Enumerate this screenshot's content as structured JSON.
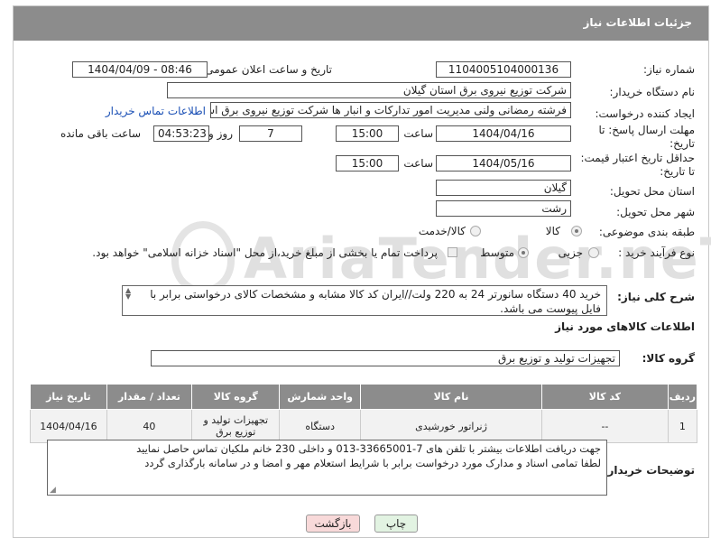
{
  "header": {
    "title": "جزئیات اطلاعات نیاز"
  },
  "fields": {
    "need_number_label": "شماره نیاز:",
    "need_number": "1104005104000136",
    "announce_label": "تاریخ و ساعت اعلان عمومی:",
    "announce_value": "1404/04/09 - 08:46",
    "buyer_org_label": "نام دستگاه خریدار:",
    "buyer_org": "شرکت توزیع نیروی برق استان گیلان",
    "creator_label": "ایجاد کننده درخواست:",
    "creator": "فرشته رمضانی ولنی مدیریت امور تدارکات و انبار ها شرکت توزیع نیروی برق استا",
    "contact_link": "اطلاعات تماس خریدار",
    "deadline_label": "مهلت ارسال پاسخ: تا تاریخ:",
    "deadline_date": "1404/04/16",
    "time_label": "ساعت",
    "deadline_time": "15:00",
    "days_value": "7",
    "days_label": "روز و",
    "remaining_time": "04:53:23",
    "remaining_label": "ساعت باقی مانده",
    "validity_label": "حداقل تاریخ اعتبار قیمت: تا تاریخ:",
    "validity_date": "1404/05/16",
    "validity_time": "15:00",
    "province_label": "استان محل تحویل:",
    "province": "گیلان",
    "city_label": "شهر محل تحویل:",
    "city": "رشت",
    "category_label": "طبقه بندی موضوعی:",
    "category_opt1": "کالا",
    "category_opt2": "کالا/خدمت",
    "process_label": "نوع فرآیند خرید :",
    "process_opt1": "جزیی",
    "process_opt2": "متوسط",
    "process_note": "پرداخت تمام یا بخشی از مبلغ خرید،از محل \"اسناد خزانه اسلامی\" خواهد بود.",
    "desc_label": "شرح کلی نیاز:",
    "desc": "خرید 40 دستگاه سانورتر 24 به 220 ولت//ایران کد کالا مشابه و مشخصات کالای درخواستی برابر با فایل پیوست می باشد.",
    "goods_info_title": "اطلاعات کالاهای مورد نیاز",
    "goods_group_label": "گروه کالا:",
    "goods_group": "تجهیزات تولید و توزیع برق"
  },
  "table": {
    "headers": [
      "ردیف",
      "کد کالا",
      "نام کالا",
      "واحد شمارش",
      "گروه کالا",
      "تعداد / مقدار",
      "تاریخ نیاز"
    ],
    "rows": [
      [
        "1",
        "--",
        "ژنراتور خورشیدی",
        "دستگاه",
        "تجهیزات تولید و توزیع برق",
        "40",
        "1404/04/16"
      ]
    ]
  },
  "notes": {
    "label": "توضیحات خریدار:",
    "line1": "جهت دریافت اطلاعات بیشتر با تلفن های 7-33665001-013 و داخلی 230 خانم ملکیان تماس حاصل نمایید",
    "line2": "لطفا تمامی اسناد و مدارک مورد درخواست برابر با شرایط استعلام مهر و امضا و در سامانه بارگذاری گردد"
  },
  "buttons": {
    "print": "چاپ",
    "back": "بازگشت"
  },
  "watermark": "AriaTender.neT",
  "colors": {
    "header_bg": "#8c8c8c",
    "link": "#1a4fb5",
    "back_btn": "#f8d9d9",
    "print_btn": "#e2f3e2"
  }
}
